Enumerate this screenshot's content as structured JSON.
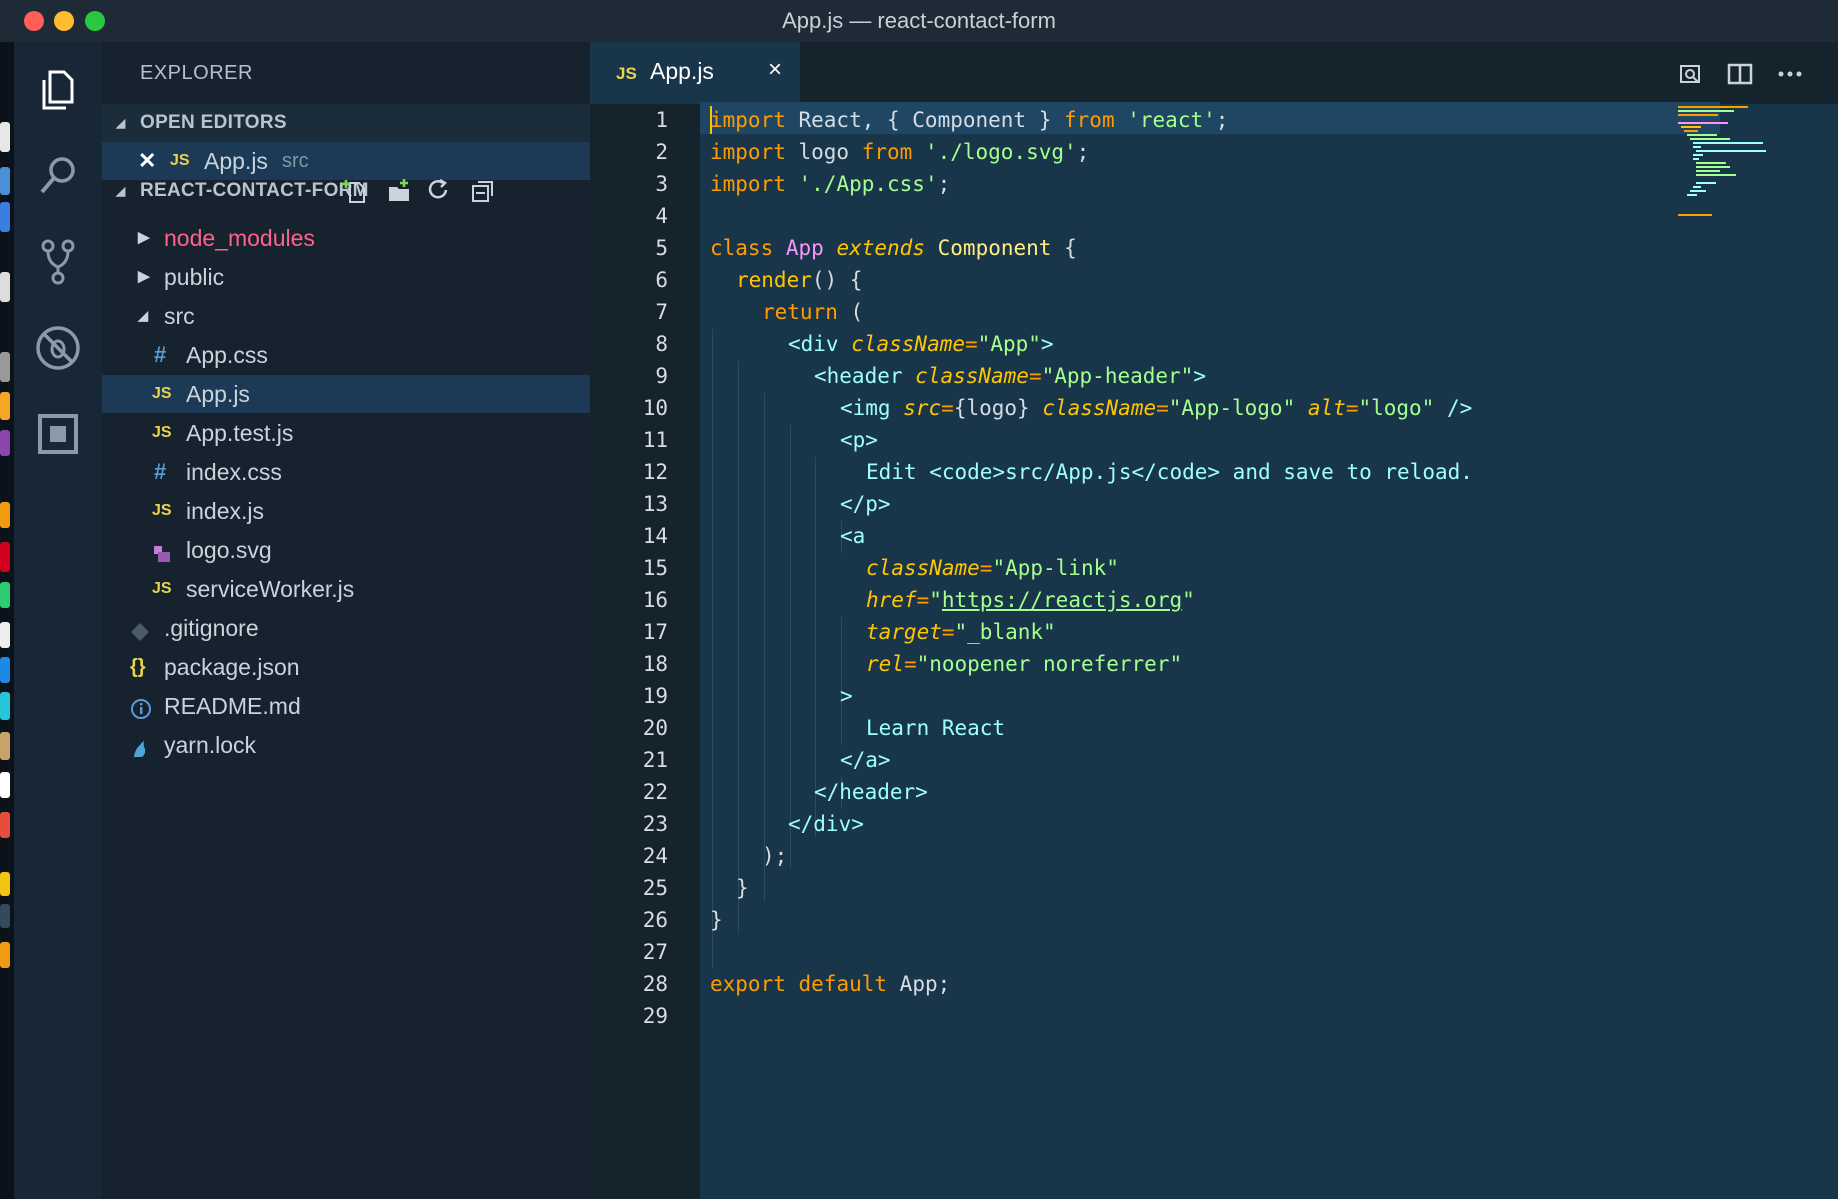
{
  "window": {
    "title": "App.js — react-contact-form"
  },
  "explorer": {
    "title": "EXPLORER",
    "open_editors": {
      "label": "OPEN EDITORS",
      "items": [
        {
          "name": "App.js",
          "path": "src"
        }
      ]
    },
    "project": {
      "label": "REACT-CONTACT-FORM",
      "tree": [
        {
          "name": "node_modules",
          "kind": "folder",
          "expanded": false
        },
        {
          "name": "public",
          "kind": "folder",
          "expanded": false
        },
        {
          "name": "src",
          "kind": "folder",
          "expanded": true
        },
        {
          "name": "App.css",
          "kind": "css"
        },
        {
          "name": "App.js",
          "kind": "js",
          "selected": true
        },
        {
          "name": "App.test.js",
          "kind": "js"
        },
        {
          "name": "index.css",
          "kind": "css"
        },
        {
          "name": "index.js",
          "kind": "js"
        },
        {
          "name": "logo.svg",
          "kind": "svg"
        },
        {
          "name": "serviceWorker.js",
          "kind": "js"
        },
        {
          "name": ".gitignore",
          "kind": "git"
        },
        {
          "name": "package.json",
          "kind": "json"
        },
        {
          "name": "README.md",
          "kind": "info"
        },
        {
          "name": "yarn.lock",
          "kind": "yarn"
        }
      ]
    }
  },
  "icons": {
    "activity": [
      "files-icon",
      "search-icon",
      "source-control-icon",
      "debug-icon",
      "extensions-icon"
    ],
    "section_actions": [
      "new-file-icon",
      "new-folder-icon",
      "refresh-icon",
      "collapse-all-icon"
    ],
    "editor_actions": [
      "open-preview-icon",
      "split-editor-icon",
      "more-actions-icon"
    ]
  },
  "editor": {
    "tab": {
      "badge": "JS",
      "label": "App.js",
      "close": "×"
    },
    "line_numbers": [
      "1",
      "2",
      "3",
      "4",
      "5",
      "6",
      "7",
      "8",
      "9",
      "10",
      "11",
      "12",
      "13",
      "14",
      "15",
      "16",
      "17",
      "18",
      "19",
      "20",
      "21",
      "22",
      "23",
      "24",
      "25",
      "26",
      "27",
      "28",
      "29"
    ],
    "code": {
      "l1": [
        "import",
        " React, { Component } ",
        "from",
        " ",
        "'react'",
        ";"
      ],
      "l2": [
        "import",
        " logo ",
        "from",
        " ",
        "'./logo.svg'",
        ";"
      ],
      "l3": [
        "import",
        " ",
        "'./App.css'",
        ";"
      ],
      "l5": [
        "class",
        " ",
        "App",
        " ",
        "extends",
        " ",
        "Component",
        " {"
      ],
      "l6": [
        "render",
        "() {"
      ],
      "l7": [
        "return",
        " ("
      ],
      "l8": [
        "<div ",
        "className",
        "=",
        "\"App\"",
        ">"
      ],
      "l9": [
        "<header ",
        "className",
        "=",
        "\"App-header\"",
        ">"
      ],
      "l10": [
        "<img ",
        "src",
        "=",
        "{logo}",
        " ",
        "className",
        "=",
        "\"App-logo\"",
        " ",
        "alt",
        "=",
        "\"logo\"",
        " />"
      ],
      "l11": [
        "<p>"
      ],
      "l12": [
        "Edit ",
        "<code>",
        "src/App.js",
        "</code>",
        " and save to reload."
      ],
      "l13": [
        "</p>"
      ],
      "l14": [
        "<a"
      ],
      "l15": [
        "className",
        "=",
        "\"App-link\""
      ],
      "l16": [
        "href",
        "=",
        "\"",
        "https://reactjs.org",
        "\""
      ],
      "l17": [
        "target",
        "=",
        "\"_blank\""
      ],
      "l18": [
        "rel",
        "=",
        "\"noopener noreferrer\""
      ],
      "l19": [
        ">"
      ],
      "l20": [
        "Learn React"
      ],
      "l21": [
        "</a>"
      ],
      "l22": [
        "</header>"
      ],
      "l23": [
        "</div>"
      ],
      "l24": [
        ");"
      ],
      "l25": [
        "}"
      ],
      "l26": [
        "}"
      ],
      "l28": [
        "export",
        " ",
        "default",
        " App;"
      ]
    }
  }
}
